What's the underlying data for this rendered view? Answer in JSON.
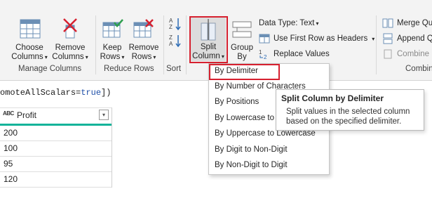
{
  "ribbon": {
    "choose_columns": {
      "line1": "Choose",
      "line2": "Columns",
      "icon": "choose-columns-icon"
    },
    "remove_columns": {
      "line1": "Remove",
      "line2": "Columns",
      "icon": "remove-columns-icon"
    },
    "manage_columns_label": "Manage Columns",
    "keep_rows": {
      "line1": "Keep",
      "line2": "Rows",
      "icon": "keep-rows-icon"
    },
    "remove_rows": {
      "line1": "Remove",
      "line2": "Rows",
      "icon": "remove-rows-icon"
    },
    "reduce_rows_label": "Reduce Rows",
    "sort_label": "Sort",
    "split_column": {
      "line1": "Split",
      "line2": "Column",
      "icon": "split-column-icon"
    },
    "group_by": {
      "line1": "Group",
      "line2": "By",
      "icon": "group-by-icon"
    },
    "data_type": "Data Type: Text",
    "use_first_row": "Use First Row as Headers",
    "replace_values": "Replace Values",
    "merge_queries": "Merge Qu",
    "append_queries": "Append Qu",
    "combine_files": "Combine F",
    "combine_label": "Combin"
  },
  "formula": {
    "prefix": "omoteAllScalars=",
    "keyword": "true",
    "suffix": "])"
  },
  "table": {
    "column_type": "ABC",
    "column_header": "Profit",
    "rows": [
      "200",
      "100",
      "95",
      "120"
    ]
  },
  "split_menu": {
    "items": [
      "By Delimiter",
      "By Number of Characters",
      "By Positions",
      "By Lowercase to Uppercase",
      "By Uppercase to Lowercase",
      "By Digit to Non-Digit",
      "By Non-Digit to Digit"
    ]
  },
  "tooltip": {
    "title": "Split Column by Delimiter",
    "body_line1": "Split values in the selected column",
    "body_line2": "based on the specified delimiter."
  },
  "colors": {
    "accent_teal": "#15b39a",
    "highlight_red": "#d6202f",
    "keyword_blue": "#1f4fa8"
  }
}
